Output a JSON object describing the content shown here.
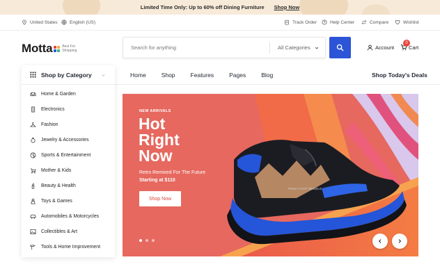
{
  "promo": {
    "text": "Limited Time Only: Up to 60% off Dining Furniture",
    "link": "Shop Now"
  },
  "utility": {
    "location": "United States",
    "language": "English (US)",
    "track_order": "Track Order",
    "help_center": "Help Center",
    "compare": "Compare",
    "wishlist": "Wishlist"
  },
  "header": {
    "logo": "Motta",
    "logo_tag_line1": "Best For",
    "logo_tag_line2": "Shopping",
    "search_placeholder": "Search for anything",
    "category_select": "All Categories",
    "account": "Account",
    "cart": "Cart",
    "cart_count": "0"
  },
  "category_menu": {
    "title": "Shop by Category",
    "items": [
      {
        "label": "Home & Garden",
        "icon": "sofa-icon"
      },
      {
        "label": "Electronics",
        "icon": "device-icon"
      },
      {
        "label": "Fashion",
        "icon": "hanger-icon"
      },
      {
        "label": "Jewelry & Accessories",
        "icon": "ring-icon"
      },
      {
        "label": "Sports & Entertainment",
        "icon": "ball-icon"
      },
      {
        "label": "Mother & Kids",
        "icon": "stroller-icon"
      },
      {
        "label": "Beauty & Health",
        "icon": "lipstick-icon"
      },
      {
        "label": "Toys & Games",
        "icon": "toy-icon"
      },
      {
        "label": "Automobiles & Motorcycles",
        "icon": "car-icon"
      },
      {
        "label": "Collectibles & Art",
        "icon": "picture-icon"
      },
      {
        "label": "Tools & Home Improvement",
        "icon": "hammer-icon"
      }
    ]
  },
  "nav": {
    "links": [
      "Home",
      "Shop",
      "Features",
      "Pages",
      "Blog"
    ],
    "right": "Shop Today's Deals"
  },
  "hero": {
    "eyebrow": "NEW ARRIVALS",
    "title_line1": "Hot",
    "title_line2": "Right",
    "title_line3": "Now",
    "subtitle": "Retro Remixed For The Future",
    "price": "Starting at $110",
    "button": "Shop Now",
    "slide_count": 3,
    "active_slide": 1,
    "shoe_text": "PUMA X HOT WHEELS"
  },
  "colors": {
    "accent_blue": "#2b54d6",
    "hero_red": "#e6685f",
    "promo_bg": "#f7ead8",
    "badge_red": "#e8443a"
  }
}
